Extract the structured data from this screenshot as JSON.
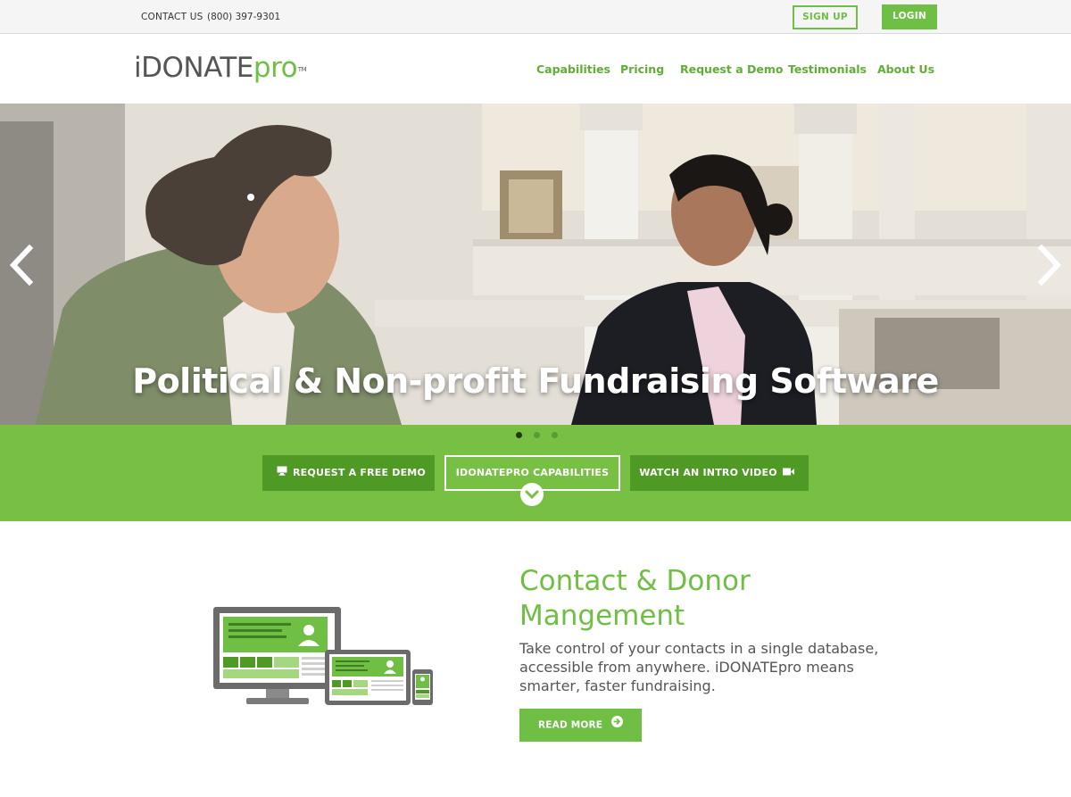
{
  "topbar": {
    "contact_label": "CONTACT US",
    "phone": "(800) 397-9301",
    "signup_label": "SIGN UP",
    "login_label": "LOGIN"
  },
  "header": {
    "logo_main": "iDONATE",
    "logo_suffix": "pro",
    "logo_tm": "TM",
    "nav": [
      "Capabilities",
      "Pricing",
      "Request a Demo",
      "Testimonials",
      "About Us"
    ]
  },
  "hero": {
    "title": "Political & Non-profit Fundraising Software",
    "slide_count": 3,
    "active_slide": 1
  },
  "cta": {
    "demo_label": "REQUEST A FREE DEMO",
    "capabilities_label": "IDONATEPRO CAPABILITIES",
    "video_label": "WATCH AN INTRO VIDEO"
  },
  "feature": {
    "title": "Contact & Donor Mangement",
    "body": "Take control of your contacts in a single database, accessible from anywhere. iDONATEpro means smarter, faster fundraising.",
    "button_label": "READ MORE"
  },
  "colors": {
    "brand_green": "#6fbf44",
    "strip_green": "#77c043",
    "dark_green_button": "#4f9a25"
  },
  "icons": [
    "monitor-icon",
    "video-camera-icon",
    "chevron-down-icon",
    "arrow-right-circle-icon",
    "chevron-left-icon",
    "chevron-right-icon"
  ]
}
